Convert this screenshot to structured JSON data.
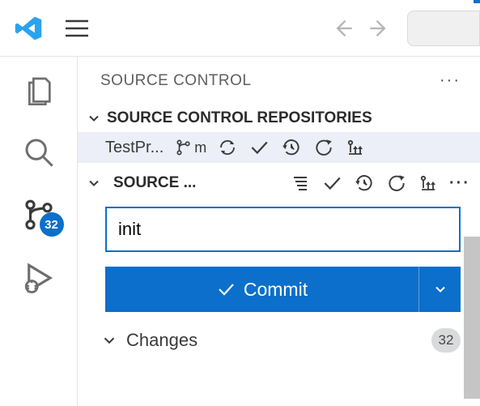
{
  "activity": {
    "scm_badge": "32"
  },
  "panel": {
    "title": "SOURCE CONTROL",
    "repos_section": "SOURCE CONTROL REPOSITORIES",
    "repo_name": "TestPr...",
    "branch_label": "m",
    "sc_section": "SOURCE ...",
    "commit_message": "init",
    "commit_button": "Commit",
    "changes_label": "Changes",
    "changes_count": "32"
  }
}
